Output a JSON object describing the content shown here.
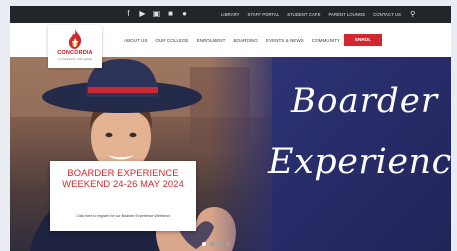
{
  "topbar": {
    "social_icons": [
      "facebook-icon",
      "youtube-icon",
      "instagram-icon",
      "linkedin-icon",
      "apple-icon"
    ],
    "links": [
      "LIBRARY",
      "STAFF PORTAL",
      "STUDENT CAFE",
      "PARENT LOUNGE",
      "CONTACT US"
    ],
    "search_icon": "search-icon"
  },
  "logo": {
    "name": "CONCORDIA",
    "subtitle": "LUTHERAN COLLEGE"
  },
  "nav": {
    "items": [
      "ABOUT US",
      "OUR COLLEGE",
      "ENROLMENT",
      "BOARDING",
      "EVENTS & NEWS",
      "COMMUNITY"
    ],
    "enrol_label": "ENROL"
  },
  "hero": {
    "script_line_1": "Boarder",
    "script_line_2": "Experience",
    "promo_title": "BOARDER EXPERIENCE WEEKEND 24-26 MAY 2024",
    "promo_body": "Click here to register for our Boarder Experience Weekend",
    "slide_count": 4,
    "active_slide": 1
  },
  "colors": {
    "accent_red": "#d4262f",
    "topbar": "#22262b",
    "hero_navy": "#2a2f6e"
  }
}
